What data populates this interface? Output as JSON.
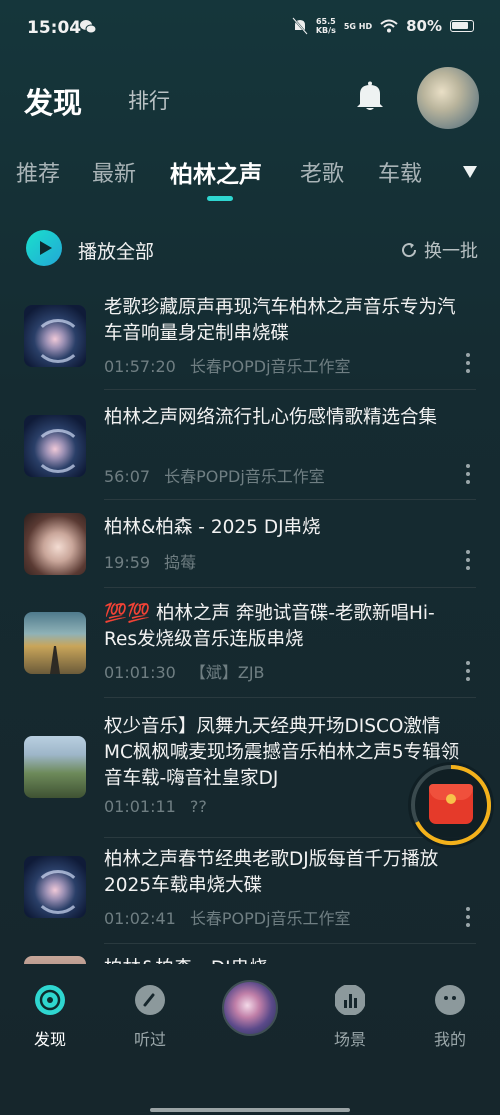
{
  "status": {
    "time": "15:04",
    "speed_top": "65.5",
    "speed_unit": "KB/s",
    "signal": "5G HD",
    "battery": "80%"
  },
  "header": {
    "title": "发现",
    "rank_tab": "排行"
  },
  "categories": [
    "推荐",
    "最新",
    "柏林之声",
    "老歌",
    "车载"
  ],
  "active_category": "柏林之声",
  "play_all": {
    "label": "播放全部",
    "refresh_label": "换一批"
  },
  "songs": [
    {
      "title": "老歌珍藏原声再现汽车柏林之声音乐专为汽车音响量身定制串烧碟",
      "duration": "01:57:20",
      "author": "长春POPDj音乐工作室"
    },
    {
      "title": "柏林之声网络流行扎心伤感情歌精选合集",
      "duration": "56:07",
      "author": "长春POPDj音乐工作室"
    },
    {
      "title": "柏林&柏森 - 2025 DJ串烧",
      "duration": "19:59",
      "author": "捣莓"
    },
    {
      "title": "💯💯 柏林之声 奔驰试音碟-老歌新唱Hi-Res发烧级音乐连版串烧",
      "duration": "01:01:30",
      "author": "【斌】ZJB"
    },
    {
      "title": "权少音乐】凤舞九天经典开场DISCO激情MC枫枫喊麦现场震撼音乐柏林之声5专辑领音车载-嗨音社皇家DJ",
      "duration": "01:01:11",
      "author": "??"
    },
    {
      "title": "柏林之声春节经典老歌DJ版每首千万播放2025车载串烧大碟",
      "duration": "01:02:41",
      "author": "长春POPDj音乐工作室"
    },
    {
      "title": "柏林&柏森 - DJ串烧",
      "duration": "",
      "author": ""
    }
  ],
  "nav": {
    "discover": "发现",
    "history": "听过",
    "scene": "场景",
    "mine": "我的"
  },
  "colors": {
    "accent": "#2fd6d0",
    "red_packet": "#e53a2a"
  }
}
